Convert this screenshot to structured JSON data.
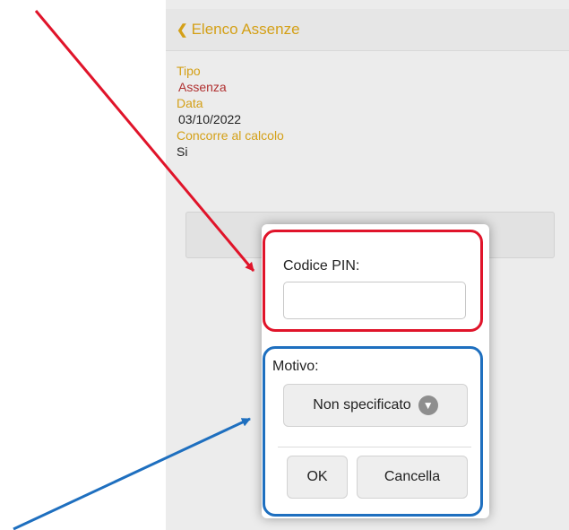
{
  "nav": {
    "back_label": "Elenco Assenze",
    "back_icon": "chevron-left-icon"
  },
  "detail": {
    "tipo_label": "Tipo",
    "tipo_value": "Assenza",
    "data_label": "Data",
    "data_value": "03/10/2022",
    "calcolo_label": "Concorre al calcolo",
    "calcolo_value": "Si"
  },
  "dialog": {
    "pin_label": "Codice PIN:",
    "pin_value": "",
    "motivo_label": "Motivo:",
    "motivo_selected": "Non specificato",
    "ok_label": "OK",
    "cancel_label": "Cancella"
  },
  "colors": {
    "accent": "#d4a017",
    "value_red": "#b03030",
    "annotation_red": "#e0142a",
    "annotation_blue": "#1e6fbf"
  }
}
